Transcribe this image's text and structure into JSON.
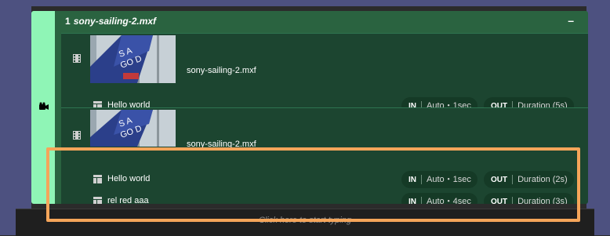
{
  "hint": "Click here to start typing",
  "part": {
    "number": "1",
    "title": "sony-sailing-2.mxf",
    "collapse_label": "–"
  },
  "pieces": [
    {
      "clip_name": "sony-sailing-2.mxf",
      "rows": [
        {
          "label": "Hello world",
          "in_tag": "IN",
          "in_value": "Auto・1sec",
          "out_tag": "OUT",
          "out_value": "Duration (5s)"
        }
      ]
    },
    {
      "clip_name": "sony-sailing-2.mxf",
      "rows": [
        {
          "label": "Hello world",
          "in_tag": "IN",
          "in_value": "Auto・1sec",
          "out_tag": "OUT",
          "out_value": "Duration (2s)"
        },
        {
          "label": "rel red aaa",
          "in_tag": "IN",
          "in_value": "Auto・4sec",
          "out_tag": "OUT",
          "out_value": "Duration (3s)"
        }
      ]
    }
  ],
  "colors": {
    "part_bg": "#2a6340",
    "part_strip": "#8ff5b6",
    "piece_bg": "#1c4530",
    "highlight": "#f5a55a",
    "side_bg": "#4d5180"
  },
  "icons": {
    "part": "camera-icon",
    "piece": "film-icon",
    "row": "template-icon",
    "collapse": "minus-icon"
  }
}
